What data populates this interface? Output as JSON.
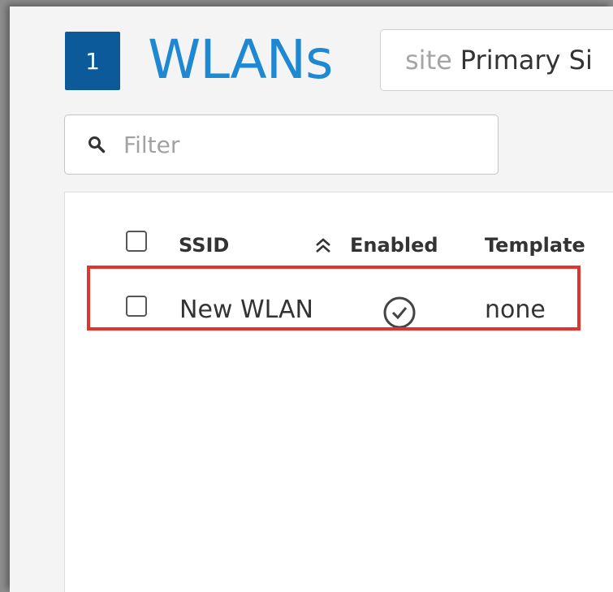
{
  "header": {
    "count": "1",
    "title": "WLANs",
    "site_label": "site",
    "site_value": "Primary Si"
  },
  "filter": {
    "placeholder": "Filter",
    "value": ""
  },
  "table": {
    "columns": [
      "SSID",
      "Enabled",
      "Template"
    ],
    "sort_column": "SSID",
    "rows": [
      {
        "ssid": "New WLAN",
        "enabled": true,
        "enabled_icon": "check-circle-icon",
        "template": "none"
      }
    ]
  },
  "colors": {
    "badge": "#0c5a9a",
    "title": "#1e88d2",
    "highlight": "#e0352f"
  }
}
